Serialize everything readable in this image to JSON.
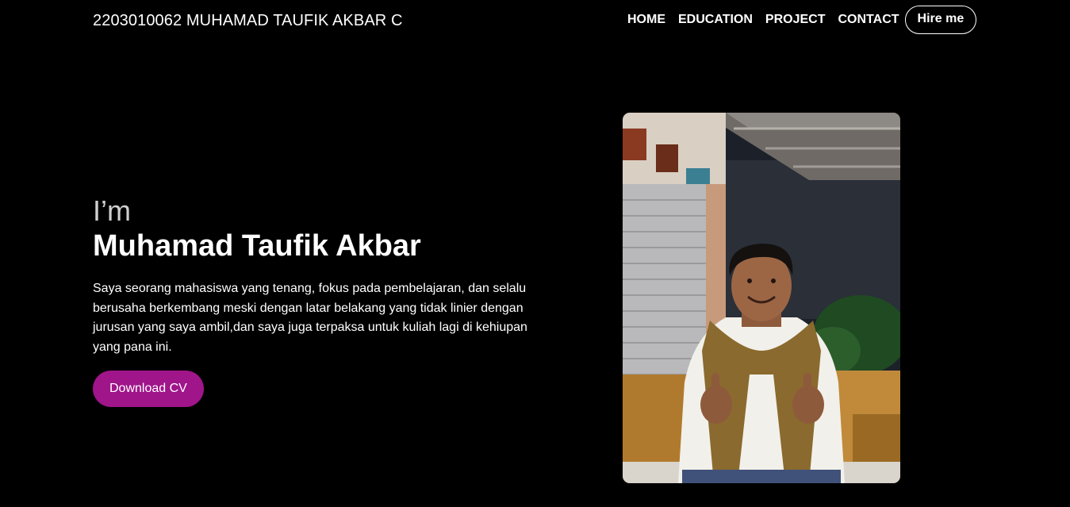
{
  "header": {
    "brand": "2203010062 MUHAMAD TAUFIK AKBAR C",
    "nav": [
      "HOME",
      "EDUCATION",
      "PROJECT",
      "CONTACT"
    ],
    "hire_label": "Hire me"
  },
  "hero": {
    "greeting": "I’m",
    "name": "Muhamad Taufik Akbar",
    "bio": "Saya seorang mahasiswa yang tenang, fokus pada pembelajaran, dan selalu berusaha berkembang meski dengan latar belakang yang tidak linier dengan jurusan yang saya ambil,dan saya juga terpaksa untuk kuliah lagi di kehiupan yang pana ini.",
    "cv_label": "Download CV"
  },
  "colors": {
    "background": "#000000",
    "accent": "#a0158a",
    "text": "#ffffff"
  }
}
